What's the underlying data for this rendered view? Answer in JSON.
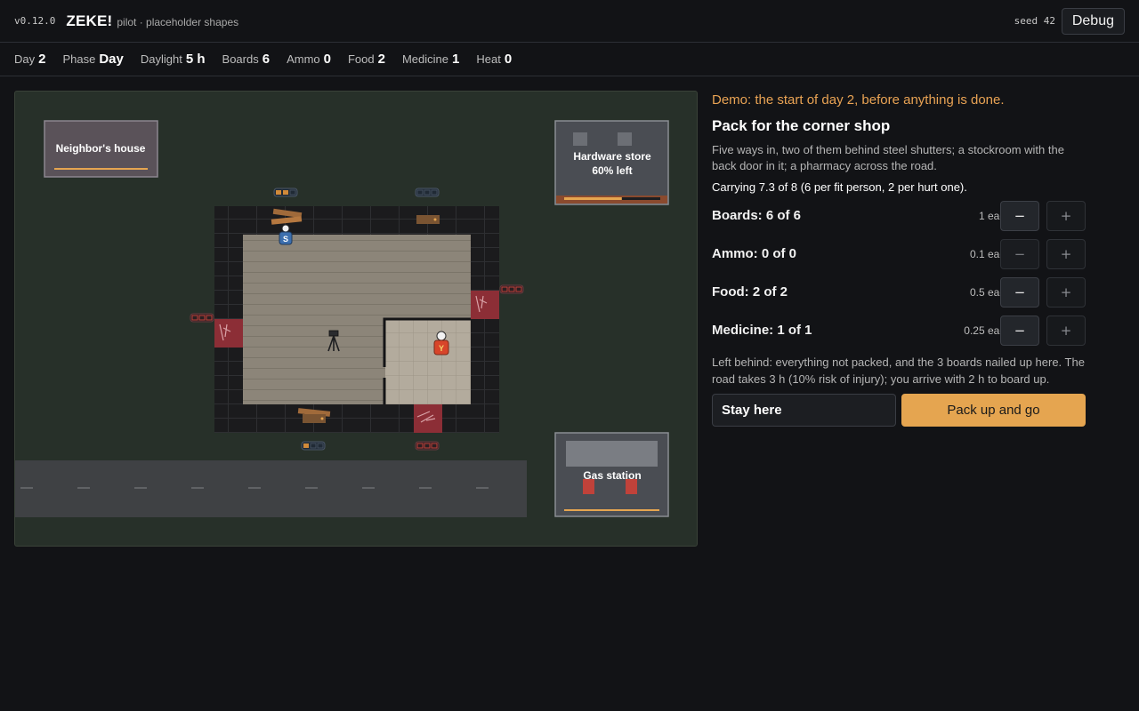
{
  "app": {
    "version": "v0.12.0",
    "name": "ZEKE!",
    "subtitle": "pilot · placeholder shapes",
    "seed_label": "seed 42",
    "debug_label": "Debug"
  },
  "status": [
    {
      "label": "Day",
      "value": "2"
    },
    {
      "label": "Phase",
      "value": "Day"
    },
    {
      "label": "Daylight",
      "value": "5 h"
    },
    {
      "label": "Boards",
      "value": "6"
    },
    {
      "label": "Ammo",
      "value": "0"
    },
    {
      "label": "Food",
      "value": "2"
    },
    {
      "label": "Medicine",
      "value": "1"
    },
    {
      "label": "Heat",
      "value": "0"
    }
  ],
  "map": {
    "locations": {
      "neighbor": "Neighbor's house",
      "hardware_name": "Hardware store",
      "hardware_stock": "60% left",
      "gas": "Gas station"
    },
    "hardware_remaining_fraction": 0.6,
    "survivors": [
      {
        "id": "S",
        "color": "#3c6fae"
      },
      {
        "id": "Y",
        "color": "#d8452a"
      }
    ]
  },
  "panel": {
    "demo": "Demo: the start of day 2, before anything is done.",
    "title": "Pack for the corner shop",
    "description": "Five ways in, two of them behind steel shutters; a stockroom with the back door in it; a pharmacy across the road.",
    "carrying": "Carrying 7.3 of 8 (6 per fit person, 2 per hurt one).",
    "items": [
      {
        "label": "Boards: 6 of 6",
        "each": "1 each",
        "minus": "−",
        "plus": "+",
        "minus_enabled": true
      },
      {
        "label": "Ammo: 0 of 0",
        "each": "0.1 each",
        "minus": "−",
        "plus": "+",
        "minus_enabled": false
      },
      {
        "label": "Food: 2 of 2",
        "each": "0.5 each",
        "minus": "−",
        "plus": "+",
        "minus_enabled": true
      },
      {
        "label": "Medicine: 1 of 1",
        "each": "0.25 each",
        "minus": "−",
        "plus": "+",
        "minus_enabled": true
      }
    ],
    "left_behind": "Left behind: everything not packed, and the 3 boards nailed up here. The road takes 3 h (10% risk of injury); you arrive with 2 h to board up.",
    "stay_label": "Stay here",
    "go_label": "Pack up and go"
  },
  "colors": {
    "accent": "#e5a550",
    "demo_text": "#e9a354",
    "map_ground": "#273029",
    "breach": "#8c2e36"
  }
}
